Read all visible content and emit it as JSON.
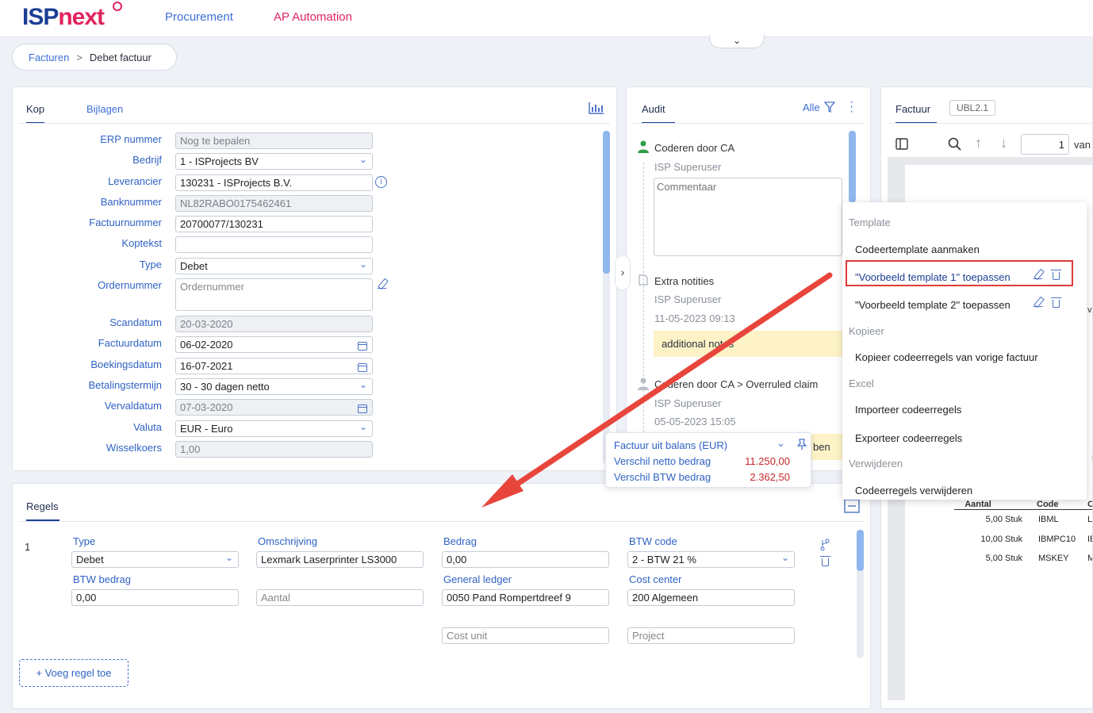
{
  "app": {
    "logo_part1": "ISP",
    "logo_part2": "next",
    "nav": [
      "Procurement",
      "AP Automation"
    ],
    "collapse_icon": "chevron-down-icon"
  },
  "breadcrumb": {
    "parent": "Facturen",
    "sep": ">",
    "current": "Debet factuur"
  },
  "kop": {
    "tabs": [
      "Kop",
      "Bijlagen"
    ],
    "fields": [
      {
        "label": "ERP nummer",
        "value": "Nog te bepalen",
        "ro": true
      },
      {
        "label": "Bedrijf",
        "value": "1 - ISProjects BV",
        "type": "select"
      },
      {
        "label": "Leverancier",
        "value": "130231 - ISProjects B.V.",
        "info": true
      },
      {
        "label": "Banknummer",
        "value": "NL82RABO0175462461",
        "ro": true
      },
      {
        "label": "Factuurnummer",
        "value": "20700077/130231"
      },
      {
        "label": "Koptekst",
        "value": ""
      },
      {
        "label": "Type",
        "value": "Debet",
        "type": "select"
      },
      {
        "label": "Ordernummer",
        "placeholder": "Ordernummer",
        "type": "textarea"
      },
      {
        "label": "Scandatum",
        "value": "20-03-2020",
        "ro": true
      },
      {
        "label": "Factuurdatum",
        "value": "06-02-2020",
        "type": "date"
      },
      {
        "label": "Boekingsdatum",
        "value": "16-07-2021",
        "type": "date"
      },
      {
        "label": "Betalingstermijn",
        "value": "30 - 30 dagen netto",
        "type": "select"
      },
      {
        "label": "Vervaldatum",
        "value": "07-03-2020",
        "type": "date",
        "ro": true
      },
      {
        "label": "Valuta",
        "value": "EUR - Euro",
        "type": "select"
      },
      {
        "label": "Wisselkoers",
        "value": "1,00",
        "ro": true
      }
    ]
  },
  "audit": {
    "tab": "Audit",
    "filter": "Alle",
    "entries": [
      {
        "title": "Coderen door CA",
        "user": "ISP Superuser",
        "comment_placeholder": "Commentaar"
      },
      {
        "title": "Extra notities",
        "user": "ISP Superuser",
        "date": "11-05-2023 09:13",
        "note": "additional notes"
      },
      {
        "title": "Coderen door CA > Overruled claim",
        "user": "ISP Superuser",
        "date": "05-05-2023 15:05",
        "note": "ben"
      }
    ]
  },
  "balance": {
    "title": "Factuur uit balans (EUR)",
    "rows": [
      {
        "label": "Verschil netto bedrag",
        "value": "11.250,00"
      },
      {
        "label": "Verschil BTW bedrag",
        "value": "2.362,50"
      }
    ]
  },
  "factuur": {
    "tabs": [
      "Factuur",
      "UBL2.1"
    ],
    "page": "1",
    "van": "van",
    "table": {
      "headers": [
        "Aantal",
        "Code",
        "Oms"
      ],
      "rows": [
        [
          "5,00",
          "Stuk",
          "IBML",
          "Lexm"
        ],
        [
          "10,00",
          "Stuk",
          "IBMPC10",
          "IBM I"
        ],
        [
          "5,00",
          "Stuk",
          "MSKEY",
          "Micro"
        ]
      ]
    },
    "side_chars": [
      "v",
      "5"
    ]
  },
  "menu": {
    "sections": [
      {
        "header": "Template",
        "items": [
          {
            "label": "Codeertemplate aanmaken"
          },
          {
            "label": "\"Voorbeeld template 1\" toepassen",
            "actions": true,
            "highlight": true
          },
          {
            "label": "\"Voorbeeld template 2\" toepassen",
            "actions": true
          }
        ]
      },
      {
        "header": "Kopieer",
        "items": [
          {
            "label": "Kopieer codeerregels van vorige factuur"
          }
        ]
      },
      {
        "header": "Excel",
        "items": [
          {
            "label": "Importeer codeerregels"
          },
          {
            "label": "Exporteer codeerregels"
          }
        ]
      },
      {
        "header": "Verwijderen",
        "items": [
          {
            "label": "Codeerregels verwijderen"
          }
        ]
      }
    ]
  },
  "regels": {
    "tab": "Regels",
    "line_no": "1",
    "labels": {
      "type": "Type",
      "omschrijving": "Omschrijving",
      "bedrag": "Bedrag",
      "btw_code": "BTW code",
      "btw_bedrag": "BTW bedrag",
      "general_ledger": "General ledger",
      "cost_center": "Cost center"
    },
    "values": {
      "type": "Debet",
      "omschrijving": "Lexmark Laserprinter LS3000",
      "bedrag": "0,00",
      "btw_code": "2 - BTW 21 %",
      "btw_bedrag": "0,00",
      "general_ledger": "0050 Pand Rompertdreef 9",
      "cost_center": "200 Algemeen"
    },
    "placeholders": {
      "aantal": "Aantal",
      "cost_unit": "Cost unit",
      "project": "Project"
    },
    "add_button": "+ Voeg regel toe"
  },
  "colors": {
    "accent": "#1c3f94",
    "brand": "#e0245e",
    "link": "#3c6fd6",
    "highlight_border": "#e03b3b",
    "arrow": "#e8453c",
    "note_bg": "#fdf3c7",
    "negative": "#c62828"
  }
}
